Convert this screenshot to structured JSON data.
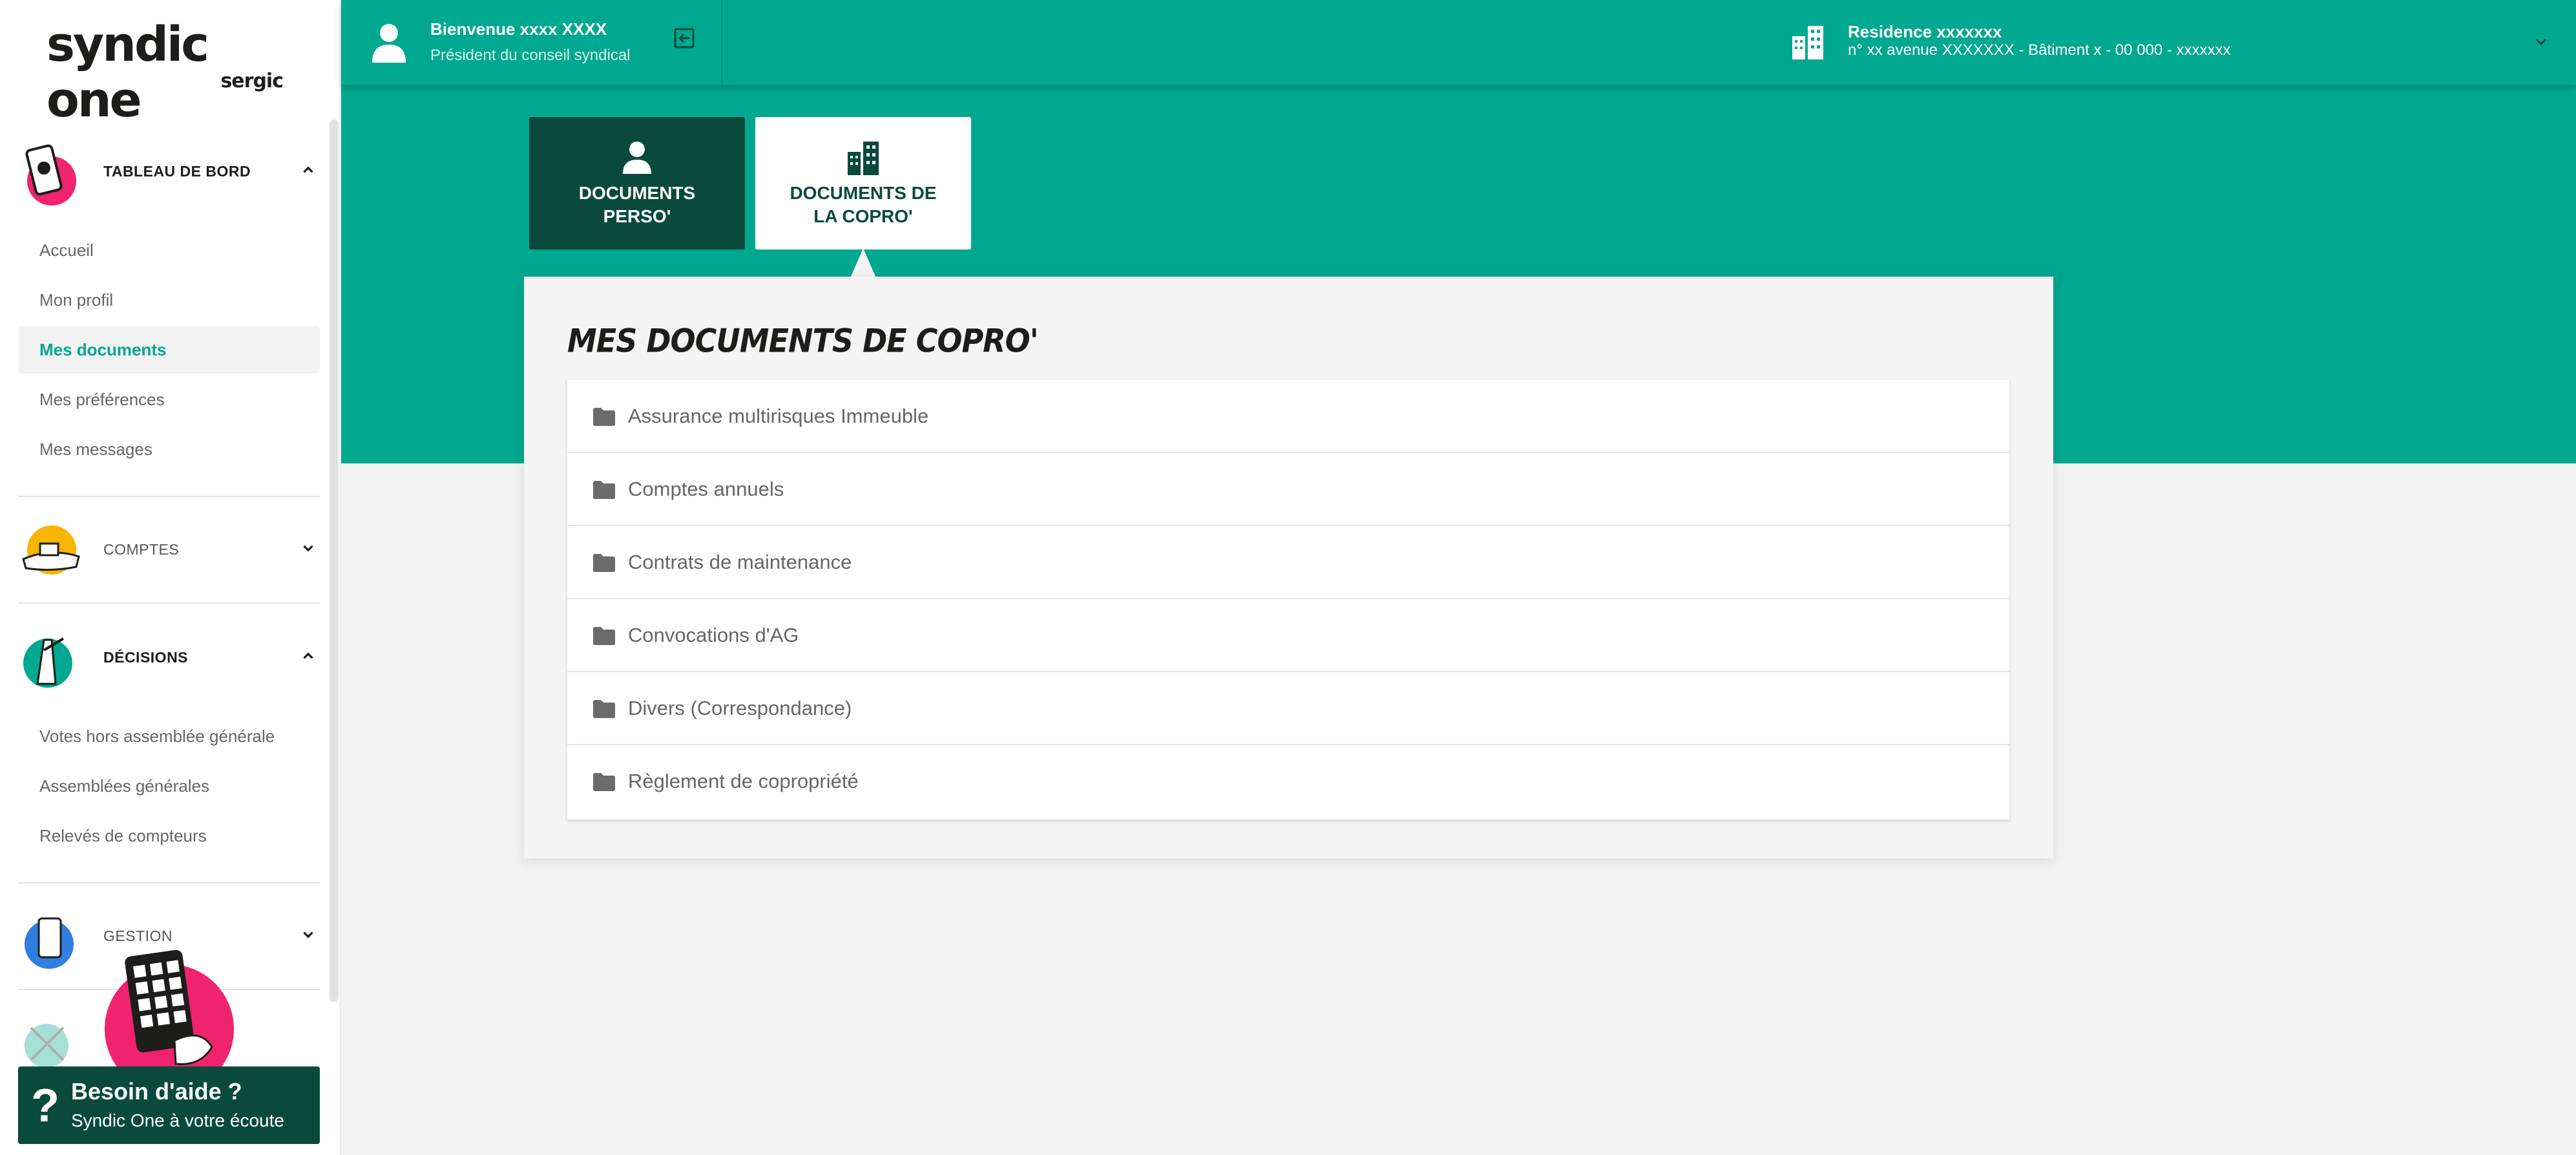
{
  "brand": {
    "name": "syndic one",
    "sub": "sergic"
  },
  "header": {
    "welcome": "Bienvenue xxxx XXXX",
    "role": "Président du conseil syndical",
    "residence_name": "Residence xxxxxxx",
    "residence_address": "n° xx avenue XXXXXXX - Bâtiment x - 00 000 - xxxxxxx"
  },
  "sidebar": {
    "sections": [
      {
        "label": "TABLEAU DE BORD",
        "expanded": true
      },
      {
        "label": "COMPTES",
        "expanded": false
      },
      {
        "label": "DÉCISIONS",
        "expanded": true
      },
      {
        "label": "GESTION",
        "expanded": false
      }
    ],
    "dashboard_items": [
      {
        "label": "Accueil",
        "active": false
      },
      {
        "label": "Mon profil",
        "active": false
      },
      {
        "label": "Mes documents",
        "active": true
      },
      {
        "label": "Mes préférences",
        "active": false
      },
      {
        "label": "Mes messages",
        "active": false
      }
    ],
    "decision_items": [
      {
        "label": "Votes hors assemblée générale"
      },
      {
        "label": "Assemblées générales"
      },
      {
        "label": "Relevés de compteurs"
      }
    ]
  },
  "help": {
    "icon": "?",
    "title": "Besoin d'aide ?",
    "subtitle": "Syndic One à votre écoute"
  },
  "tabs": [
    {
      "label": "DOCUMENTS\nPERSO'",
      "icon": "user-icon",
      "selected": false
    },
    {
      "label": "DOCUMENTS DE\nLA COPRO'",
      "icon": "buildings-icon",
      "selected": true
    }
  ],
  "documents": {
    "title": "MES DOCUMENTS DE COPRO'",
    "folders": [
      "Assurance multirisques Immeuble",
      "Comptes annuels",
      "Contrats de maintenance",
      "Convocations d'AG",
      "Divers (Correspondance)",
      "Règlement de copropriété"
    ]
  },
  "colors": {
    "primary": "#00a88f",
    "dark": "#0a4a3c",
    "accent_pink": "#f0236f",
    "accent_yellow": "#f7b500"
  }
}
